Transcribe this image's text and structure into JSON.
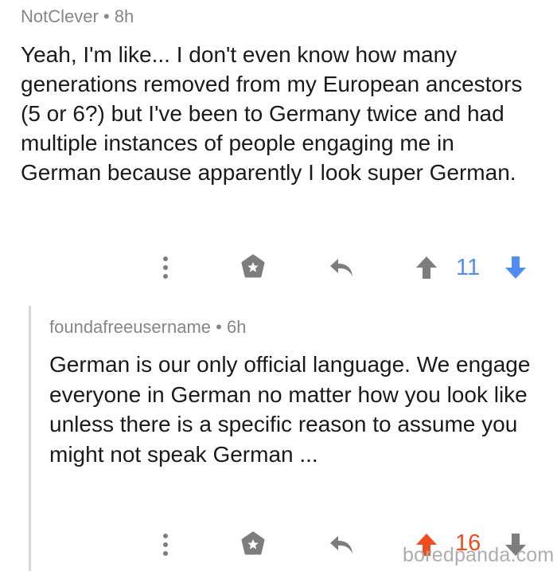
{
  "comment": {
    "username": "NotClever",
    "separator": "•",
    "time": "8h",
    "text": "Yeah, I'm like... I don't even know how many generations removed from my European ancestors (5 or 6?) but I've been to Germany twice and had multiple instances of people engaging me in German because apparently I look super German.",
    "score": "11",
    "vote_state": "downvoted",
    "score_color": "#4f8df5"
  },
  "reply": {
    "username": "foundafreeusername",
    "separator": "•",
    "time": "6h",
    "text": "German is our only official language. We engage everyone in German no matter how you look like unless there is a specific reason to assume you might not speak German ...",
    "score": "16",
    "vote_state": "upvoted",
    "score_color": "#f14b20"
  },
  "icons": {
    "more": "more-vertical-icon",
    "award": "award-icon",
    "reply": "reply-icon",
    "upvote": "upvote-arrow-icon",
    "downvote": "downvote-arrow-icon"
  },
  "colors": {
    "icon_gray": "#7d7d7d",
    "downvote_blue": "#4f8df5",
    "upvote_orange": "#f14b20"
  },
  "watermark": "boredpanda.com"
}
